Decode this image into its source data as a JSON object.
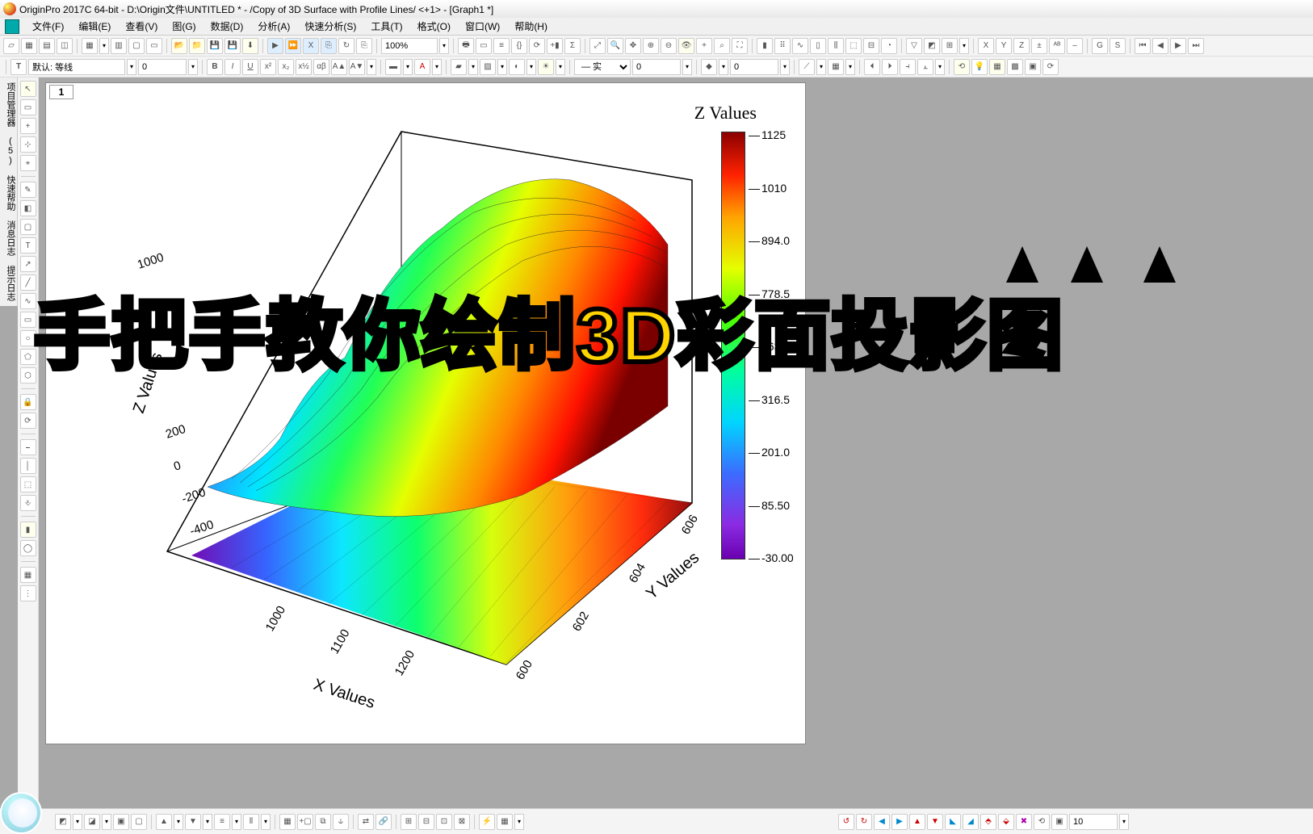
{
  "title": "OriginPro 2017C 64-bit - D:\\Origin文件\\UNTITLED * - /Copy of 3D Surface with Profile Lines/ <+1> - [Graph1 *]",
  "menu": {
    "file": "文件(F)",
    "edit": "编辑(E)",
    "view": "查看(V)",
    "plot": "图(G)",
    "data": "数据(D)",
    "analysis": "分析(A)",
    "quick": "快速分析(S)",
    "tools": "工具(T)",
    "format": "格式(O)",
    "window": "窗口(W)",
    "help": "帮助(H)"
  },
  "toolbar1": {
    "zoom": "100%"
  },
  "toolbar2": {
    "fontlabel": "默认: 等线",
    "size": "0",
    "spin1": "0",
    "spin2": "0"
  },
  "lefttabs": {
    "pm": "项目管理器 (5)",
    "qh": "快速帮助",
    "ml": "消息日志",
    "hl": "提示日志"
  },
  "sheet_tab": "1",
  "overlay": "手把手教你绘制3D彩面投影图",
  "chart_data": {
    "type": "surface3d",
    "title": "",
    "x_label": "X Values",
    "y_label": "Y Values",
    "z_label": "Z Values",
    "colorbar_title": "Z Values",
    "x_ticks": [
      "1000",
      "1100",
      "1200"
    ],
    "y_ticks": [
      "600",
      "602",
      "604",
      "606"
    ],
    "z_ticks": [
      "-400",
      "-200",
      "0",
      "200",
      "400",
      "1000"
    ],
    "colorbar_ticks": [
      "1125",
      "1010",
      "894.0",
      "778.5",
      "663.0",
      "316.5",
      "201.0",
      "85.50",
      "-30.00"
    ],
    "x_range": [
      950,
      1250
    ],
    "y_range": [
      599,
      607
    ],
    "z_range": [
      -400,
      1125
    ],
    "description": "3D colour-mapped surface with floor projection; ridged surface rises from ~-30 (purple) at low X to ~1100 (dark red) at high X; multiple peaks along Y."
  },
  "bottom": {
    "val": "10"
  }
}
